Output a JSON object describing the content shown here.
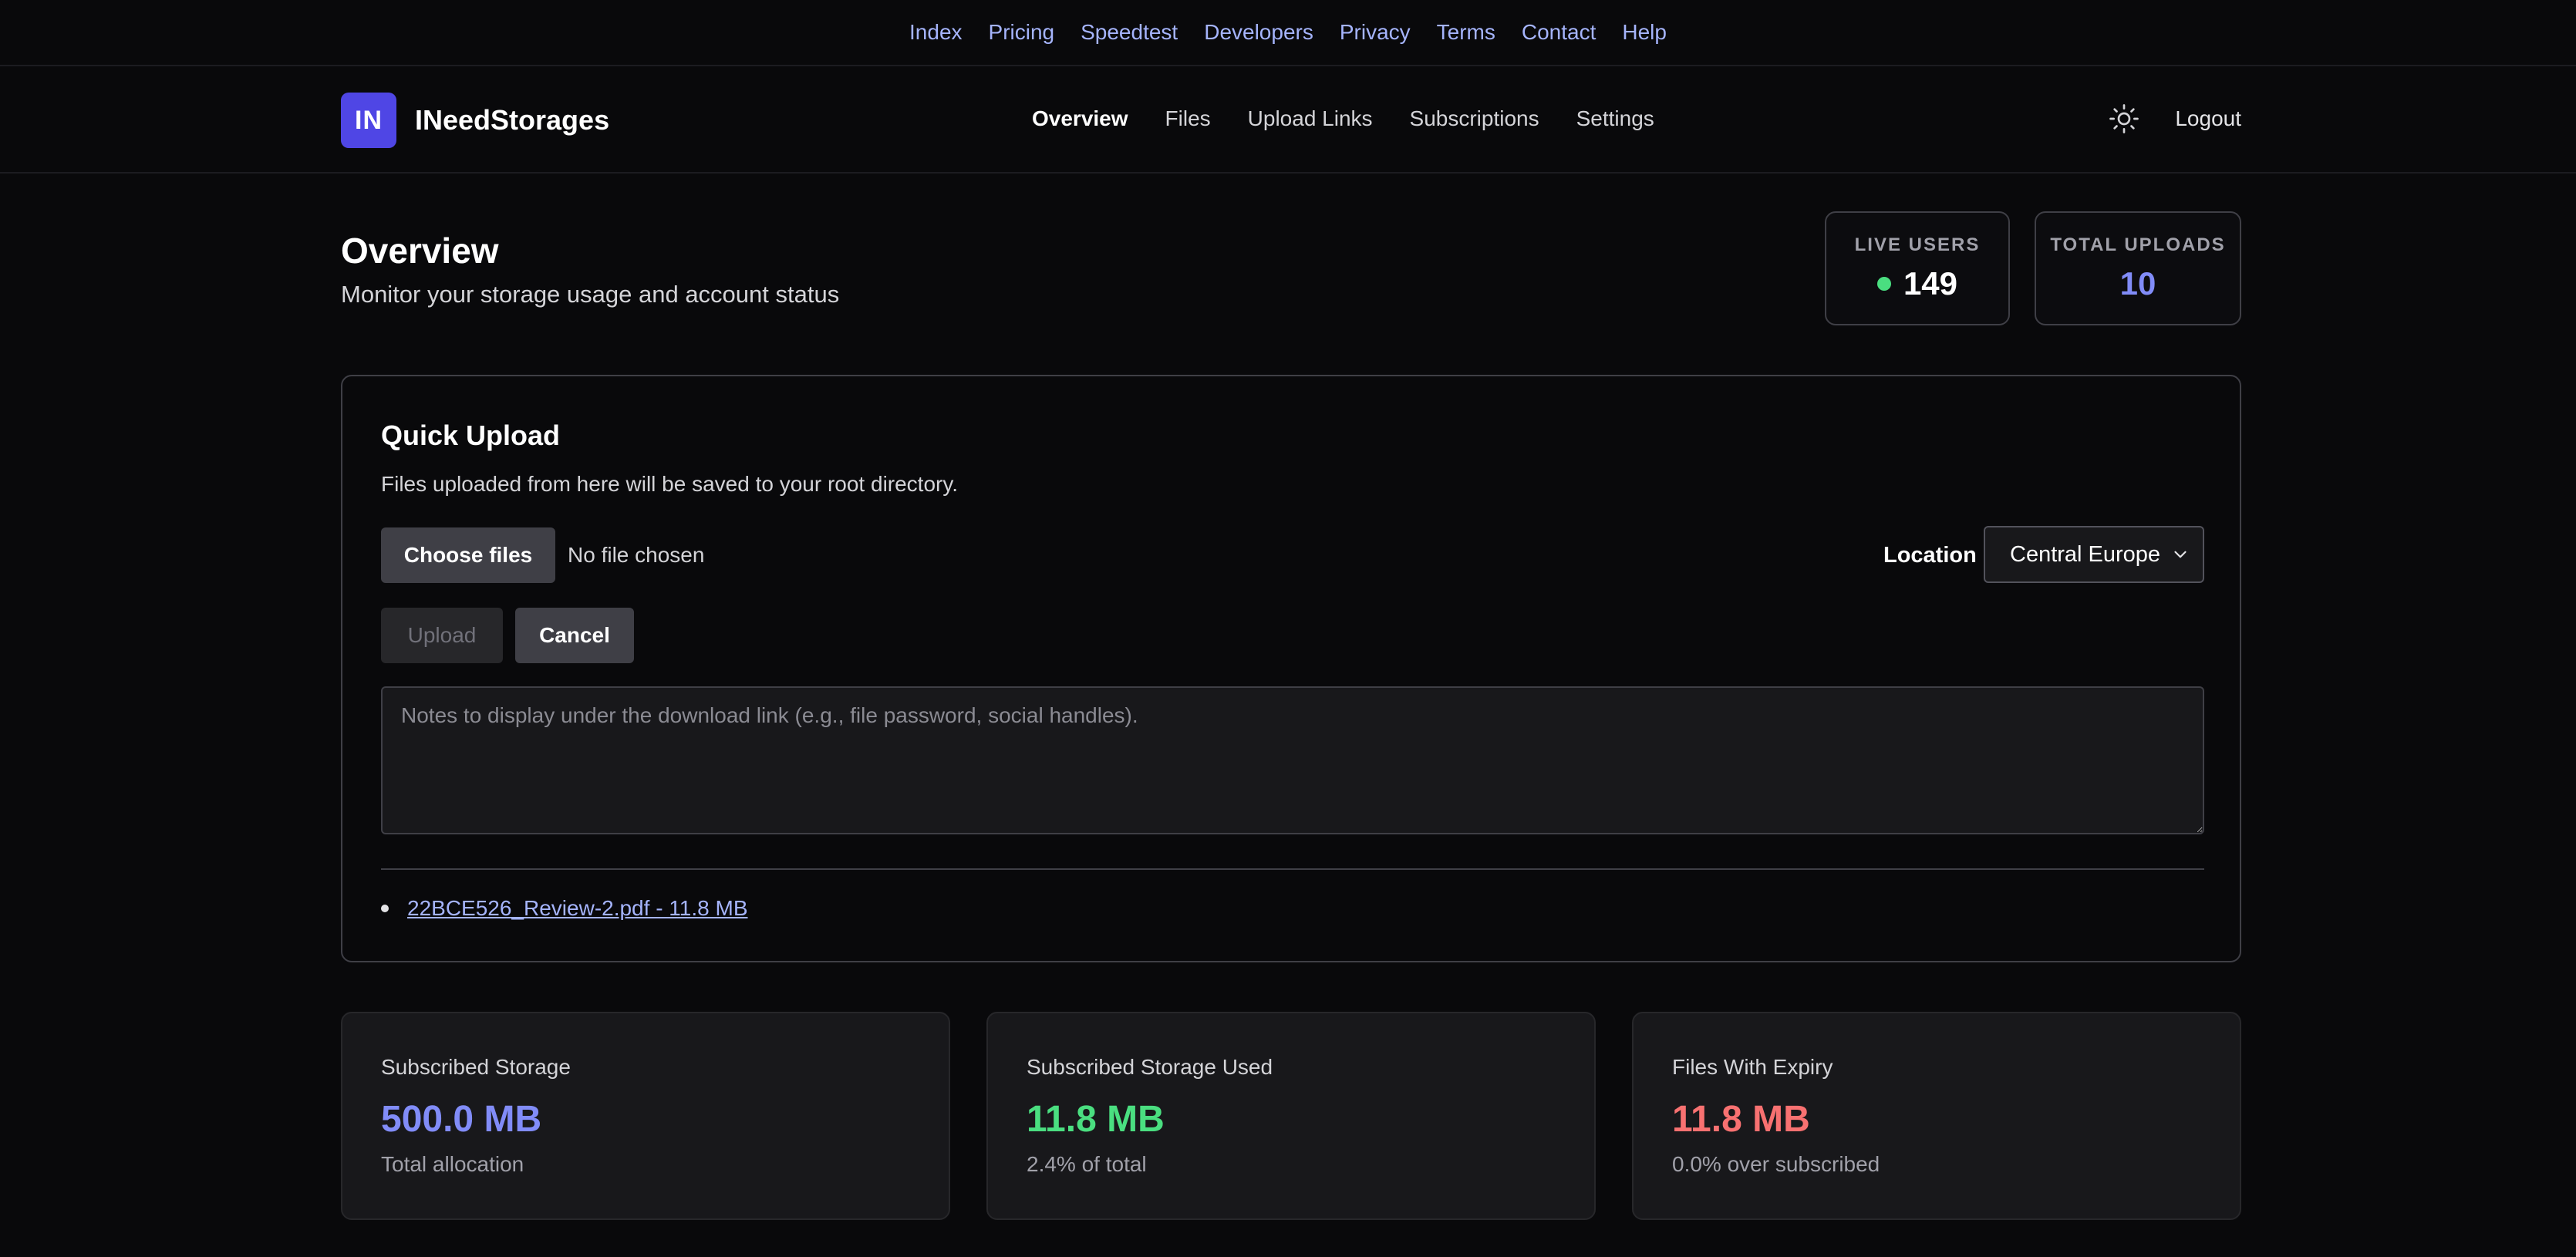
{
  "topnav": [
    "Index",
    "Pricing",
    "Speedtest",
    "Developers",
    "Privacy",
    "Terms",
    "Contact",
    "Help"
  ],
  "brand": {
    "logo_text": "IN",
    "name": "INeedStorages"
  },
  "mainnav": [
    {
      "label": "Overview",
      "active": true
    },
    {
      "label": "Files",
      "active": false
    },
    {
      "label": "Upload Links",
      "active": false
    },
    {
      "label": "Subscriptions",
      "active": false
    },
    {
      "label": "Settings",
      "active": false
    }
  ],
  "header": {
    "theme_icon": "sun-icon",
    "logout": "Logout"
  },
  "page": {
    "title": "Overview",
    "subtitle": "Monitor your storage usage and account status"
  },
  "stats": {
    "live_users": {
      "label": "LIVE USERS",
      "value": "149",
      "dot_color": "#4ade80"
    },
    "total_uploads": {
      "label": "TOTAL UPLOADS",
      "value": "10",
      "color": "#818cf8"
    }
  },
  "quick_upload": {
    "title": "Quick Upload",
    "description": "Files uploaded from here will be saved to your root directory.",
    "choose_label": "Choose files",
    "no_file": "No file chosen",
    "location_label": "Location",
    "location_value": "Central Europe",
    "upload_label": "Upload",
    "cancel_label": "Cancel",
    "notes_placeholder": "Notes to display under the download link (e.g., file password, social handles).",
    "files": [
      "22BCE526_Review-2.pdf - 11.8 MB"
    ]
  },
  "summary": [
    {
      "label": "Subscribed Storage",
      "value": "500.0 MB",
      "sub": "Total allocation",
      "color": "#818cf8"
    },
    {
      "label": "Subscribed Storage Used",
      "value": "11.8 MB",
      "sub": "2.4% of total",
      "color": "#4ade80"
    },
    {
      "label": "Files With Expiry",
      "value": "11.8 MB",
      "sub": "0.0% over subscribed",
      "color": "#f87171"
    }
  ]
}
